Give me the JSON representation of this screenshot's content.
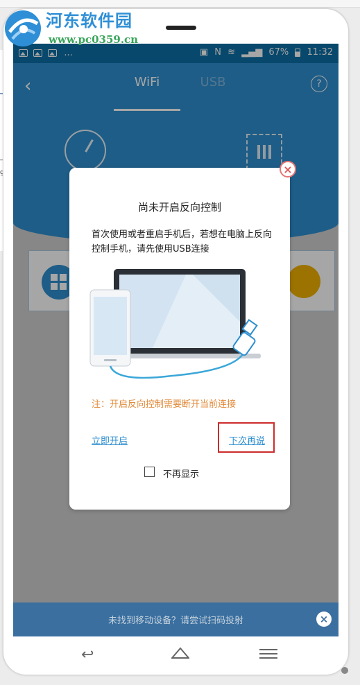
{
  "watermark": {
    "title": "河东软件园",
    "url": "www.pc0359.cn"
  },
  "left_peek": {
    "text1": "_1",
    "text2": "g"
  },
  "status_bar": {
    "left_dots": "...",
    "battery": "67%",
    "time": "11:32"
  },
  "app_bar": {
    "tabs": [
      {
        "label": "WiFi",
        "active": true
      },
      {
        "label": "USB",
        "active": false
      }
    ],
    "help": "?"
  },
  "dialog": {
    "title": "尚未开启反向控制",
    "body": "首次使用或者重启手机后，若想在电脑上反向控制手机，请先使用USB连接",
    "note": "注：开启反向控制需要断开当前连接",
    "enable_now": "立即开启",
    "later": "下次再说",
    "dont_show": "不再显示",
    "dont_show_checked": false
  },
  "bottom_tip": {
    "text": "未找到移动设备？请尝试扫码投射"
  },
  "colors": {
    "primary": "#2f8fd0",
    "note": "#e28a3a",
    "highlight": "#cc2b2b",
    "status": "#0d6fa6"
  }
}
